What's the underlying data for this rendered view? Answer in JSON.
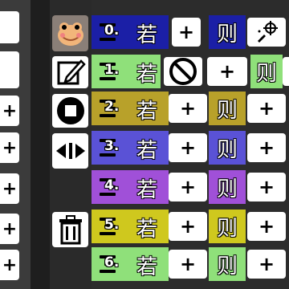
{
  "left_buttons": [
    {
      "label": "+"
    },
    {
      "label": "+"
    },
    {
      "label": "+"
    },
    {
      "label": "+"
    },
    {
      "label": "+"
    },
    {
      "label": "+"
    }
  ],
  "tools": [
    {
      "icon": "frog-avatar-icon"
    },
    {
      "icon": "edit-icon"
    },
    {
      "icon": "stop-icon"
    },
    {
      "icon": "resize-horizontal-icon"
    },
    {
      "icon": "trash-icon"
    }
  ],
  "rows": [
    {
      "index": "0.",
      "if_label": "若",
      "then_label": "则",
      "plus": "+",
      "color": "#1b1fa6",
      "then_color": "#1b1fa6"
    },
    {
      "index": "1.",
      "if_label": "若",
      "then_label": "则",
      "plus": "+",
      "color": "#8fe07a",
      "then_color": "#8fe07a"
    },
    {
      "index": "2.",
      "if_label": "若",
      "then_label": "则",
      "plus": "+",
      "color": "#b8a12a",
      "then_color": "#b8a12a"
    },
    {
      "index": "3.",
      "if_label": "若",
      "then_label": "则",
      "plus": "+",
      "color": "#5a52d6",
      "then_color": "#5a52d6"
    },
    {
      "index": "4.",
      "if_label": "若",
      "then_label": "则",
      "plus": "+",
      "color": "#a050d8",
      "then_color": "#a050d8"
    },
    {
      "index": "5.",
      "if_label": "若",
      "then_label": "则",
      "plus": "+",
      "color": "#cfc81e",
      "then_color": "#cfc81e"
    },
    {
      "index": "6.",
      "if_label": "若",
      "then_label": "则",
      "plus": "+",
      "color": "#8fe07a",
      "then_color": "#8fe07a"
    }
  ],
  "row0_extra_icon": "sparkle-target-icon",
  "row1_prohibit_icon": "prohibit-icon",
  "colors": {
    "background": "#2c2c2c",
    "button": "#ffffff"
  }
}
